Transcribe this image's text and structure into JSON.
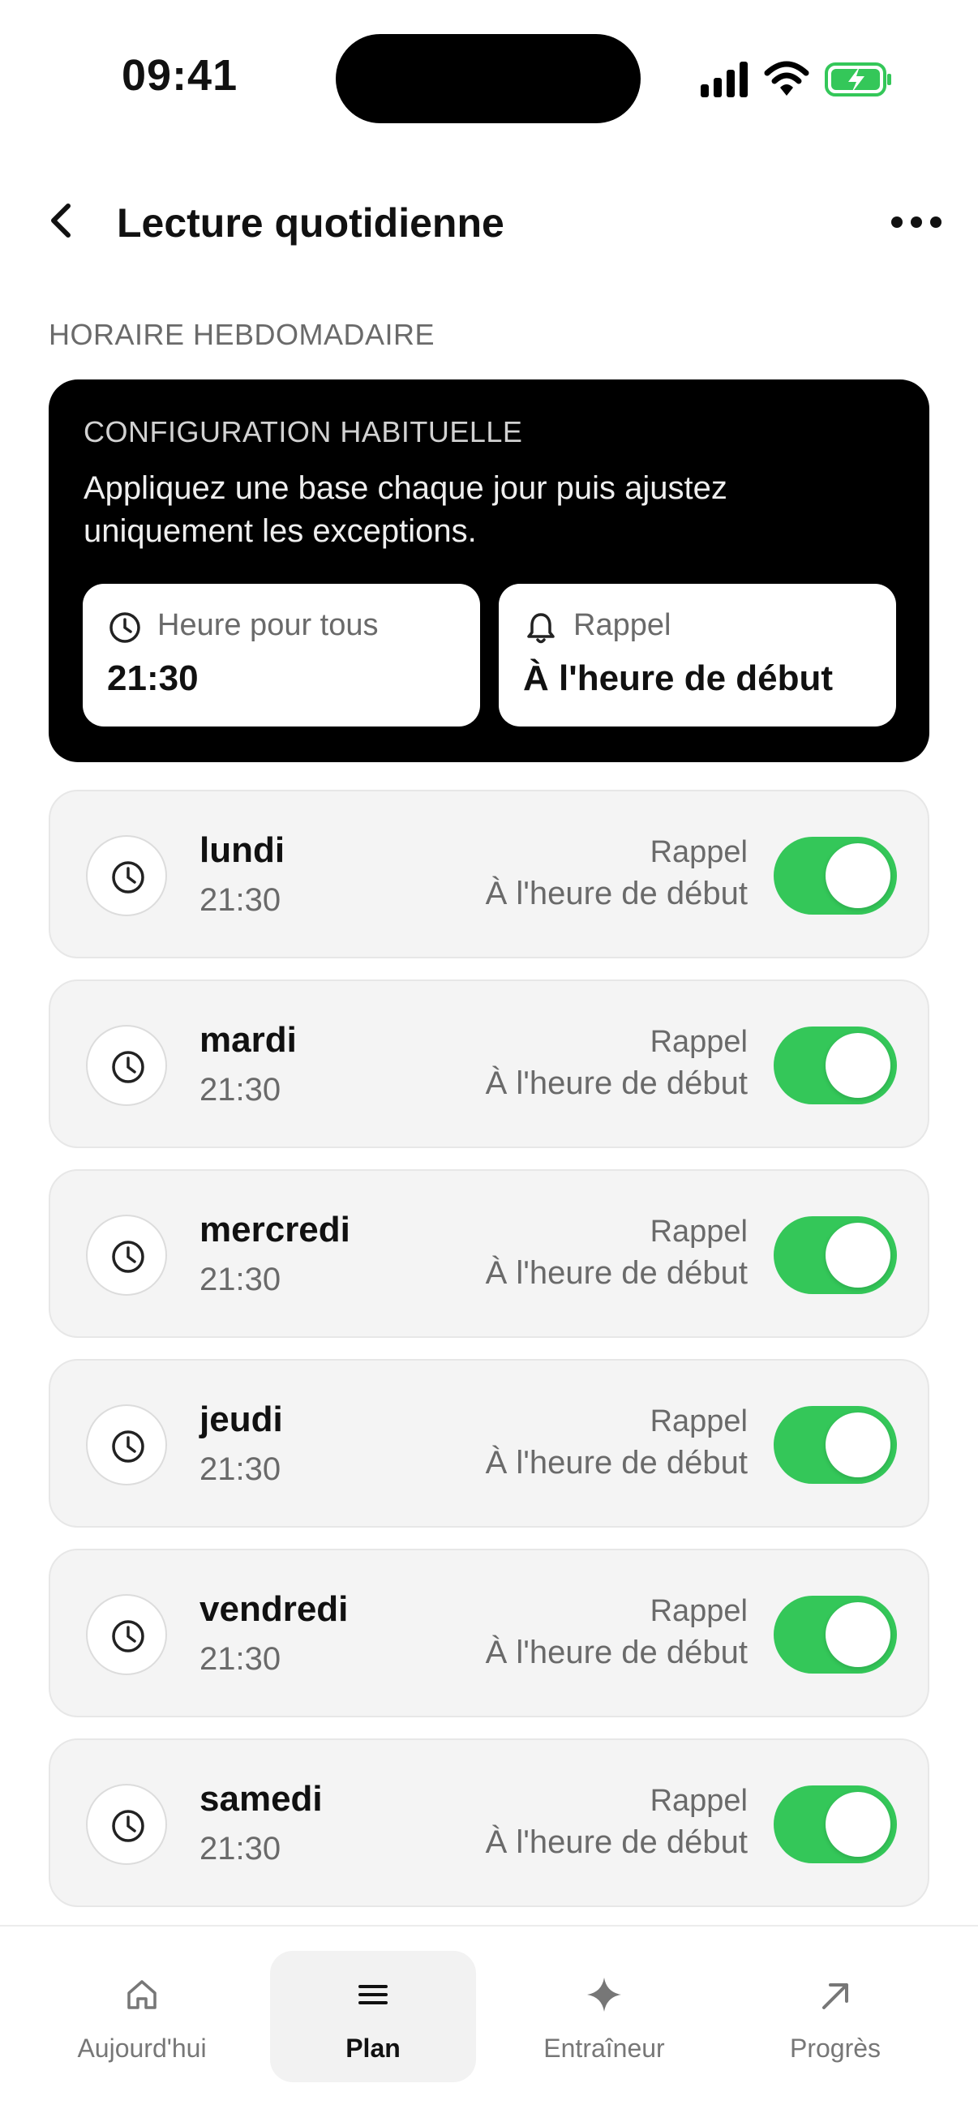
{
  "status_bar": {
    "time": "09:41"
  },
  "header": {
    "title": "Lecture quotidienne"
  },
  "section_label": "HORAIRE HEBDOMADAIRE",
  "config": {
    "title": "CONFIGURATION HABITUELLE",
    "description": "Appliquez une base chaque jour puis ajustez uniquement les exceptions.",
    "time_box": {
      "label": "Heure pour tous",
      "value": "21:30",
      "icon": "clock-icon"
    },
    "reminder_box": {
      "label": "Rappel",
      "value": "À l'heure de début",
      "icon": "bell-icon"
    }
  },
  "days": [
    {
      "name": "lundi",
      "time": "21:30",
      "reminder_label": "Rappel",
      "reminder_value": "À l'heure de début",
      "enabled": true
    },
    {
      "name": "mardi",
      "time": "21:30",
      "reminder_label": "Rappel",
      "reminder_value": "À l'heure de début",
      "enabled": true
    },
    {
      "name": "mercredi",
      "time": "21:30",
      "reminder_label": "Rappel",
      "reminder_value": "À l'heure de début",
      "enabled": true
    },
    {
      "name": "jeudi",
      "time": "21:30",
      "reminder_label": "Rappel",
      "reminder_value": "À l'heure de début",
      "enabled": true
    },
    {
      "name": "vendredi",
      "time": "21:30",
      "reminder_label": "Rappel",
      "reminder_value": "À l'heure de début",
      "enabled": true
    },
    {
      "name": "samedi",
      "time": "21:30",
      "reminder_label": "Rappel",
      "reminder_value": "À l'heure de début",
      "enabled": true
    }
  ],
  "tabs": [
    {
      "label": "Aujourd'hui",
      "icon": "home-icon",
      "active": false
    },
    {
      "label": "Plan",
      "icon": "menu-icon",
      "active": true
    },
    {
      "label": "Entraîneur",
      "icon": "sparkle-icon",
      "active": false
    },
    {
      "label": "Progrès",
      "icon": "arrow-up-right-icon",
      "active": false
    }
  ],
  "colors": {
    "toggle_on": "#34c759",
    "battery": "#34c759",
    "card_dark": "#000000",
    "card_light": "#f4f4f4"
  }
}
